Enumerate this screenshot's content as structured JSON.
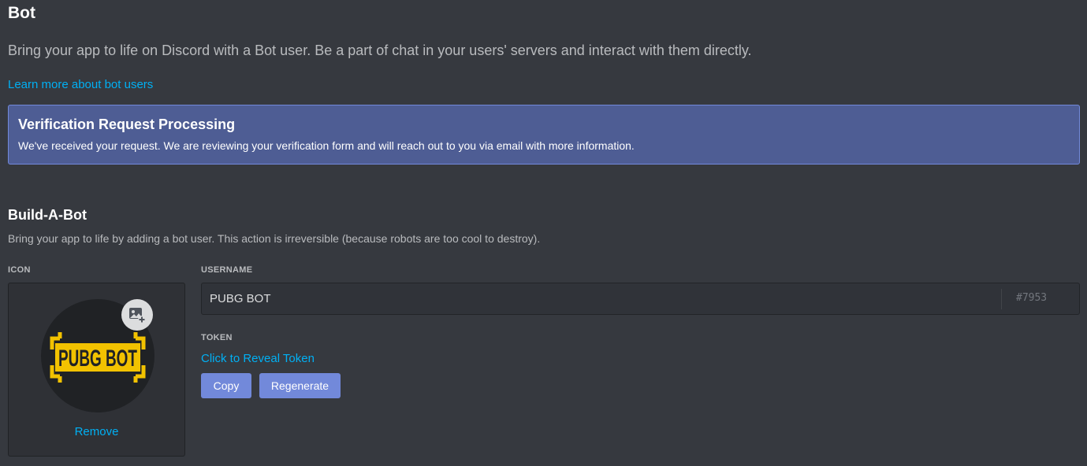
{
  "header": {
    "title": "Bot",
    "description": "Bring your app to life on Discord with a Bot user. Be a part of chat in your users' servers and interact with them directly.",
    "learn_more_link": "Learn more about bot users"
  },
  "notice": {
    "title": "Verification Request Processing",
    "text": "We've received your request. We are reviewing your verification form and will reach out to you via email with more information."
  },
  "build_a_bot": {
    "title": "Build-A-Bot",
    "description": "Bring your app to life by adding a bot user. This action is irreversible (because robots are too cool to destroy).",
    "icon_label": "ICON",
    "avatar_text": "PUBG BOT",
    "upload_icon": "add-image-icon",
    "remove_label": "Remove",
    "username_label": "USERNAME",
    "username_value": "PUBG BOT",
    "discriminator": "#7953",
    "token_label": "TOKEN",
    "reveal_token_label": "Click to Reveal Token",
    "copy_label": "Copy",
    "regenerate_label": "Regenerate"
  },
  "colors": {
    "background": "#36393f",
    "link": "#00b0f4",
    "blurple": "#7289da",
    "notice_bg": "#4e5d94",
    "pubg_yellow": "#f2c200"
  }
}
